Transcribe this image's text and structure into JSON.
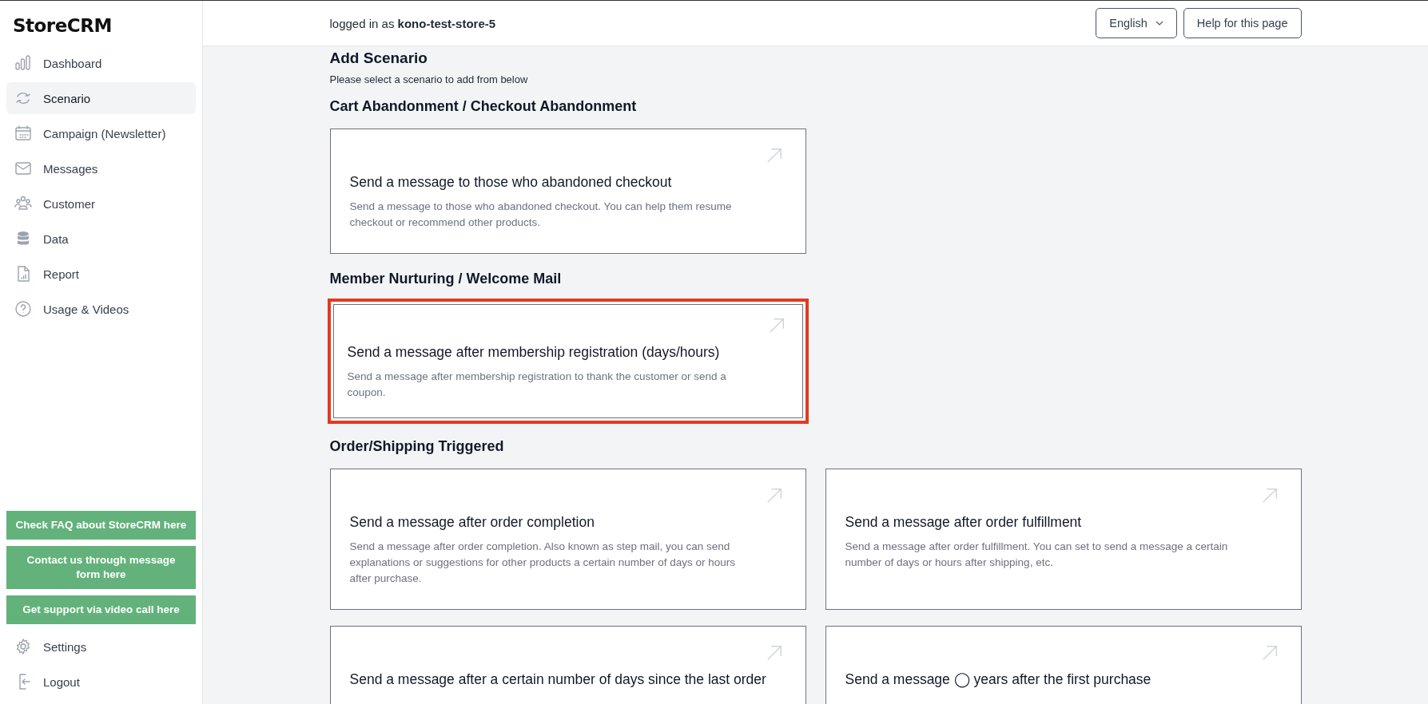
{
  "sidebar": {
    "logo": "StoreCRM",
    "items": [
      {
        "label": "Dashboard",
        "selected": false
      },
      {
        "label": "Scenario",
        "selected": true
      },
      {
        "label": "Campaign (Newsletter)",
        "selected": false
      },
      {
        "label": "Messages",
        "selected": false
      },
      {
        "label": "Customer",
        "selected": false
      },
      {
        "label": "Data",
        "selected": false
      },
      {
        "label": "Report",
        "selected": false
      },
      {
        "label": "Usage & Videos",
        "selected": false
      }
    ],
    "support_buttons": [
      "Check FAQ about StoreCRM here",
      "Contact us through message form here",
      "Get support via video call here"
    ],
    "bottom_items": [
      {
        "label": "Settings",
        "selected": false
      },
      {
        "label": "Logout",
        "selected": false
      }
    ]
  },
  "header": {
    "login_text": "logged in as **kono-test-store-5**",
    "language": "English",
    "help_button": "Help for this page"
  },
  "page": {
    "title": "Add Scenario",
    "subtitle": "Please select a scenario to add from below",
    "sections": [
      {
        "heading": "Cart Abandonment / Checkout Abandonment",
        "cards": [
          {
            "title": "Send a message to those who abandoned checkout",
            "description": "Send a message to those who abandoned checkout. You can help them resume checkout or recommend other products.",
            "highlighted": false
          }
        ]
      },
      {
        "heading": "Member Nurturing / Welcome Mail",
        "cards": [
          {
            "title": "Send a message after membership registration (days/hours)",
            "description": "Send a message after membership registration to thank the customer or send a coupon.",
            "highlighted": true
          }
        ]
      },
      {
        "heading": "Order/Shipping Triggered",
        "cards": [
          {
            "title": "Send a message after order completion",
            "description": "Send a message after order completion. Also known as step mail, you can send explanations or suggestions for other products a certain number of days or hours after purchase.",
            "highlighted": false
          },
          {
            "title": "Send a message after order fulfillment",
            "description": "Send a message after order fulfillment. You can set to send a message a certain number of days or hours after shipping, etc.",
            "highlighted": false
          },
          {
            "title": "Send a message after a certain number of days since the last order",
            "highlighted": false
          },
          {
            "title": "Send a message ◯ years after the first purchase",
            "highlighted": false
          }
        ]
      }
    ]
  }
}
